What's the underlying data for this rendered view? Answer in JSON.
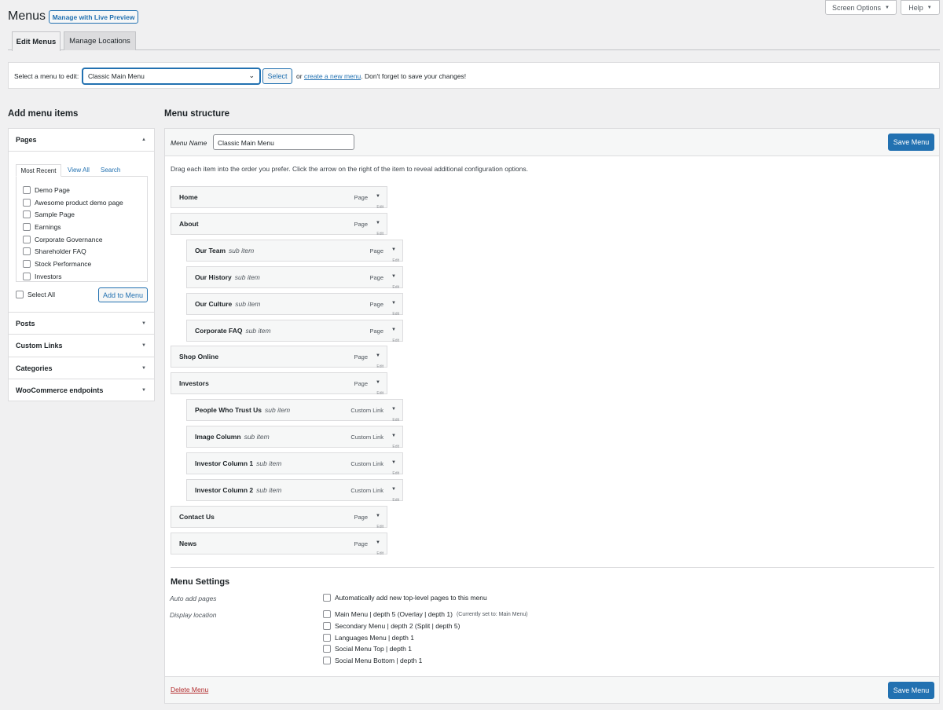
{
  "header": {
    "title": "Menus",
    "live_preview": "Manage with Live Preview",
    "screen_options": "Screen Options",
    "help": "Help"
  },
  "tabs": [
    {
      "label": "Edit Menus",
      "active": true
    },
    {
      "label": "Manage Locations",
      "active": false
    }
  ],
  "select_bar": {
    "label": "Select a menu to edit:",
    "selected": "Classic Main Menu",
    "select_button": "Select",
    "or_text": "or",
    "create_link": "create a new menu",
    "reminder": ". Don't forget to save your changes!"
  },
  "left": {
    "heading": "Add menu items",
    "pages_title": "Pages",
    "page_tabs": [
      "Most Recent",
      "View All",
      "Search"
    ],
    "pages": [
      "Demo Page",
      "Awesome product demo page",
      "Sample Page",
      "Earnings",
      "Corporate Governance",
      "Shareholder FAQ",
      "Stock Performance",
      "Investors"
    ],
    "select_all": "Select All",
    "add_button": "Add to Menu",
    "sections": [
      "Posts",
      "Custom Links",
      "Categories",
      "WooCommerce endpoints"
    ]
  },
  "structure": {
    "heading": "Menu structure",
    "name_label": "Menu Name",
    "name_value": "Classic Main Menu",
    "save_button": "Save Menu",
    "instructions": "Drag each item into the order you prefer. Click the arrow on the right of the item to reveal additional configuration options.",
    "sub_label": "sub item",
    "edit_label": "Edit",
    "items": [
      {
        "title": "Home",
        "type": "Page",
        "depth": 0
      },
      {
        "title": "About",
        "type": "Page",
        "depth": 0
      },
      {
        "title": "Our Team",
        "type": "Page",
        "depth": 1
      },
      {
        "title": "Our History",
        "type": "Page",
        "depth": 1
      },
      {
        "title": "Our Culture",
        "type": "Page",
        "depth": 1
      },
      {
        "title": "Corporate FAQ",
        "type": "Page",
        "depth": 1
      },
      {
        "title": "Shop Online",
        "type": "Page",
        "depth": 0
      },
      {
        "title": "Investors",
        "type": "Page",
        "depth": 0
      },
      {
        "title": "People Who Trust Us",
        "type": "Custom Link",
        "depth": 1
      },
      {
        "title": "Image Column",
        "type": "Custom Link",
        "depth": 1
      },
      {
        "title": "Investor Column 1",
        "type": "Custom Link",
        "depth": 1
      },
      {
        "title": "Investor Column 2",
        "type": "Custom Link",
        "depth": 1
      },
      {
        "title": "Contact Us",
        "type": "Page",
        "depth": 0
      },
      {
        "title": "News",
        "type": "Page",
        "depth": 0
      }
    ]
  },
  "settings": {
    "heading": "Menu Settings",
    "auto_label": "Auto add pages",
    "auto_option": "Automatically add new top-level pages to this menu",
    "location_label": "Display location",
    "locations": [
      {
        "label": "Main Menu | depth 5 (Overlay | depth 1)",
        "note": "(Currently set to: Main Menu)"
      },
      {
        "label": "Secondary Menu | depth 2 (Split | depth 5)",
        "note": ""
      },
      {
        "label": "Languages Menu | depth 1",
        "note": ""
      },
      {
        "label": "Social Menu Top | depth 1",
        "note": ""
      },
      {
        "label": "Social Menu Bottom | depth 1",
        "note": ""
      }
    ],
    "delete_link": "Delete Menu",
    "save_button": "Save Menu"
  },
  "colors": {
    "accent": "#2271b1",
    "danger": "#b32d2e"
  }
}
